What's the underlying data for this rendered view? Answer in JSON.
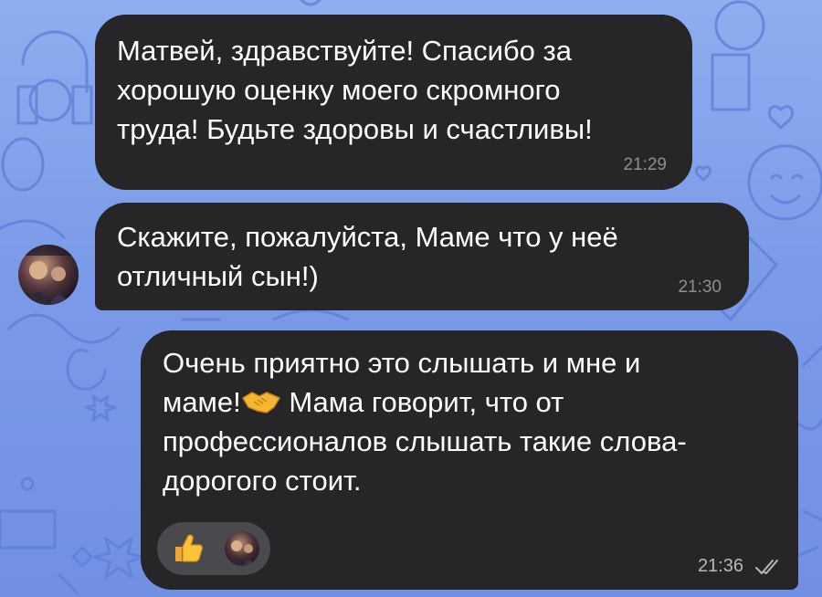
{
  "messages": [
    {
      "text": "Матвей,  здравствуйте! Спасибо за\nхорошую  оценку моего скромного\nтруда! Будьте здоровы и счастливы!",
      "time": "21:29",
      "direction": "incoming"
    },
    {
      "text": "Скажите,  пожалуйста,  Маме что у неё\nотличный сын!)",
      "time": "21:30",
      "direction": "incoming"
    },
    {
      "text_before_emoji": "Очень приятно это слышать и мне и\nмаме!",
      "emoji": "handshake",
      "text_after_emoji": " Мама говорит, что от\nпрофессионалов слышать такие слова-\nдорогого стоит.",
      "time": "21:36",
      "direction": "outgoing",
      "read_status": "double-check",
      "reaction_emoji": "thumbs-up"
    }
  ],
  "colors": {
    "bubble_bg": "#262628",
    "text": "#ffffff",
    "time": "#8e8e93",
    "background": "#7b9ae8",
    "reaction_bg": "#4a4a4e"
  }
}
